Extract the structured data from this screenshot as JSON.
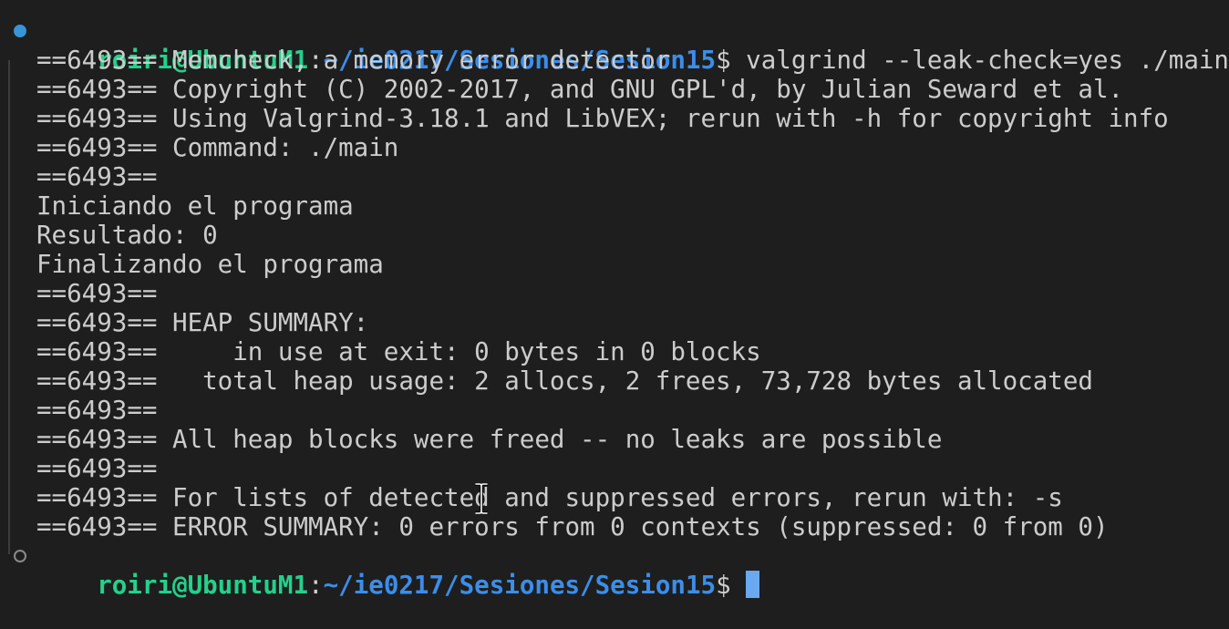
{
  "theme": {
    "background": "#1e1e1e",
    "foreground": "#cccccc",
    "prompt_user_color": "#23d18b",
    "prompt_path_color": "#3b8eea",
    "success_marker_color": "#3794d6",
    "cursor_color": "#6aa8f0"
  },
  "prompt1": {
    "user_host": "roiri@UbuntuM1",
    "separator": ":",
    "path": "~/ie0217/Sesiones/Sesion15",
    "dollar": "$",
    "command": " valgrind --leak-check=yes ./main"
  },
  "output": [
    "==6493== Memcheck, a memory error detector",
    "==6493== Copyright (C) 2002-2017, and GNU GPL'd, by Julian Seward et al.",
    "==6493== Using Valgrind-3.18.1 and LibVEX; rerun with -h for copyright info",
    "==6493== Command: ./main",
    "==6493==",
    "Iniciando el programa",
    "Resultado: 0",
    "Finalizando el programa",
    "==6493==",
    "==6493== HEAP SUMMARY:",
    "==6493==     in use at exit: 0 bytes in 0 blocks",
    "==6493==   total heap usage: 2 allocs, 2 frees, 73,728 bytes allocated",
    "==6493==",
    "==6493== All heap blocks were freed -- no leaks are possible",
    "==6493==",
    "==6493== For lists of detected and suppressed errors, rerun with: -s",
    "==6493== ERROR SUMMARY: 0 errors from 0 contexts (suppressed: 0 from 0)"
  ],
  "prompt2": {
    "user_host": "roiri@UbuntuM1",
    "separator": ":",
    "path": "~/ie0217/Sesiones/Sesion15",
    "dollar": "$"
  },
  "icons": {
    "command_success": "filled-circle-icon",
    "command_pending": "hollow-circle-icon",
    "mouse_cursor": "text-ibeam-cursor-icon"
  }
}
